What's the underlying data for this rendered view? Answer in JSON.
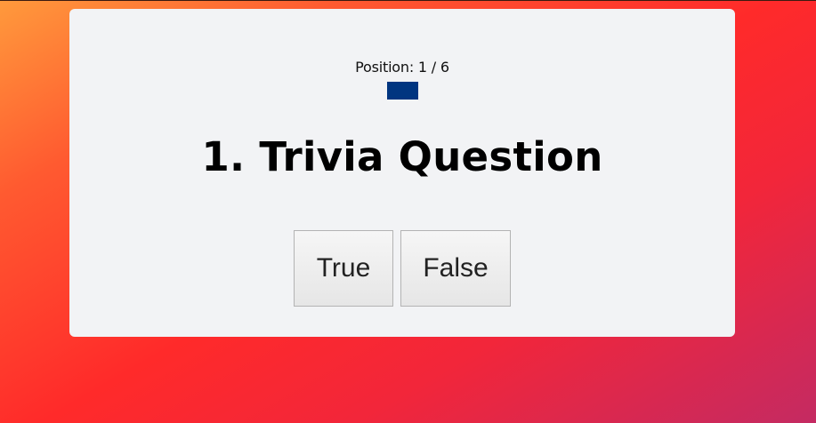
{
  "quiz": {
    "position_label": "Position: 1 / 6",
    "question_title": "1. Trivia Question",
    "flag_color": "#003580",
    "answers": [
      {
        "label": "True"
      },
      {
        "label": "False"
      }
    ]
  },
  "colors": {
    "card_background": "#f2f3f5",
    "button_border": "#b3b3b3"
  }
}
